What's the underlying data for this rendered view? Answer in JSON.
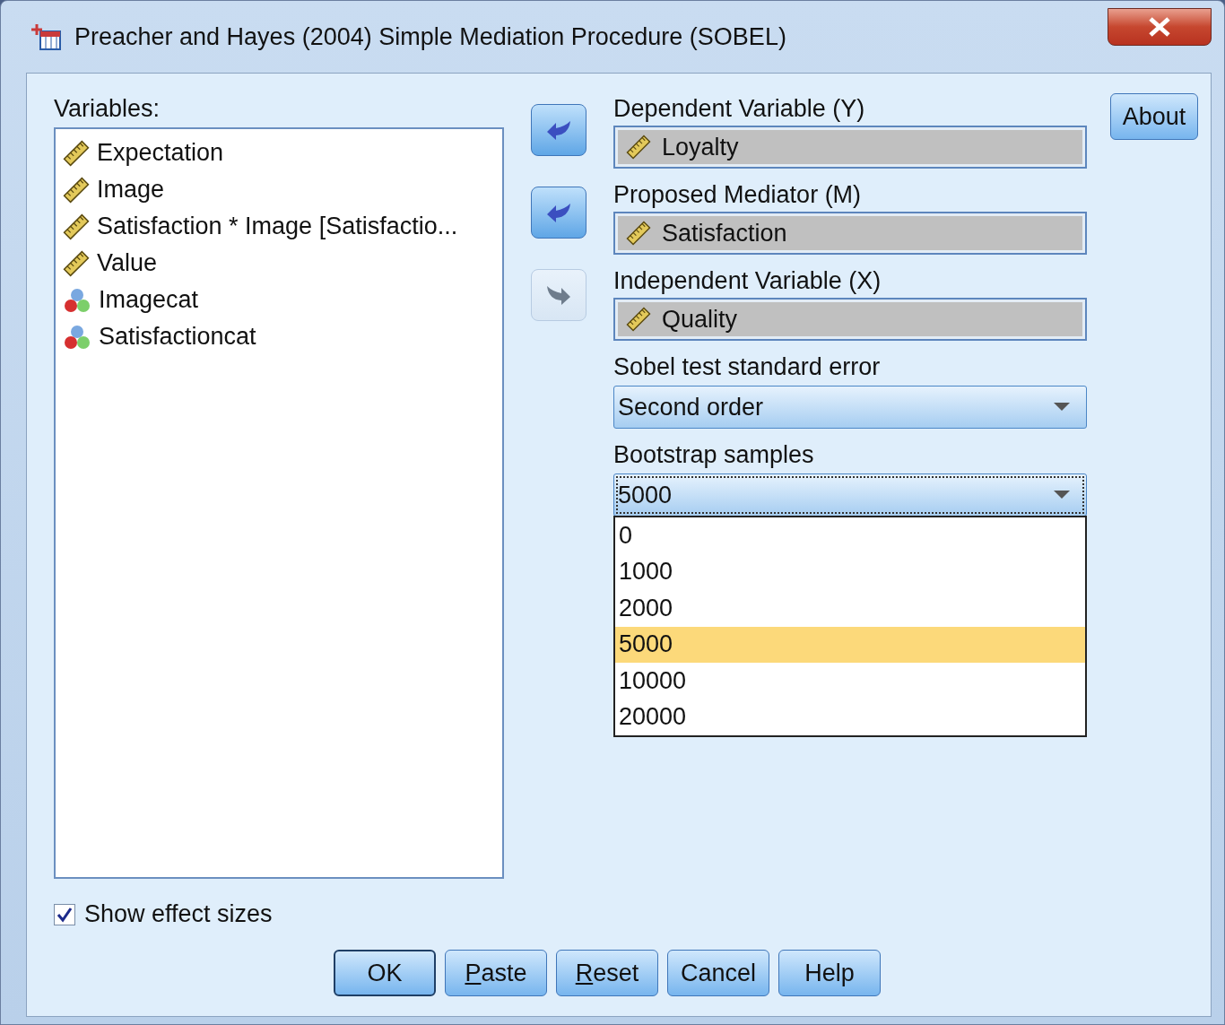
{
  "window": {
    "title": "Preacher and Hayes (2004) Simple Mediation Procedure (SOBEL)"
  },
  "variables": {
    "label": "Variables:",
    "items": [
      {
        "name": "Expectation",
        "kind": "scale"
      },
      {
        "name": "Image",
        "kind": "scale"
      },
      {
        "name": "Satisfaction * Image [Satisfactio...",
        "kind": "scale"
      },
      {
        "name": "Value",
        "kind": "scale"
      },
      {
        "name": "Imagecat",
        "kind": "nominal"
      },
      {
        "name": "Satisfactioncat",
        "kind": "nominal"
      }
    ]
  },
  "targets": [
    {
      "label": "Dependent Variable (Y)",
      "value": "Loyalty",
      "arrow": {
        "kind": "left",
        "disabled": false
      }
    },
    {
      "label": "Proposed Mediator (M)",
      "value": "Satisfaction",
      "arrow": {
        "kind": "left",
        "disabled": false
      }
    },
    {
      "label": "Independent Variable (X)",
      "value": "Quality",
      "arrow": {
        "kind": "right",
        "disabled": true
      }
    }
  ],
  "sobel": {
    "label": "Sobel test standard error",
    "value": "Second order"
  },
  "bootstrap": {
    "label": "Bootstrap samples",
    "value": "5000",
    "expanded": true,
    "options": [
      {
        "label": "0",
        "selected": false
      },
      {
        "label": "1000",
        "selected": false
      },
      {
        "label": "2000",
        "selected": false
      },
      {
        "label": "5000",
        "selected": true
      },
      {
        "label": "10000",
        "selected": false
      },
      {
        "label": "20000",
        "selected": false
      }
    ]
  },
  "about_button": "About",
  "show_effect_sizes": {
    "label": "Show effect sizes",
    "checked": true
  },
  "buttons": [
    {
      "label": "OK",
      "default": true,
      "underline_first": false
    },
    {
      "label": "Paste",
      "default": false,
      "underline_first": true
    },
    {
      "label": "Reset",
      "default": false,
      "underline_first": true
    },
    {
      "label": "Cancel",
      "default": false,
      "underline_first": false
    },
    {
      "label": "Help",
      "default": false,
      "underline_first": false
    }
  ]
}
